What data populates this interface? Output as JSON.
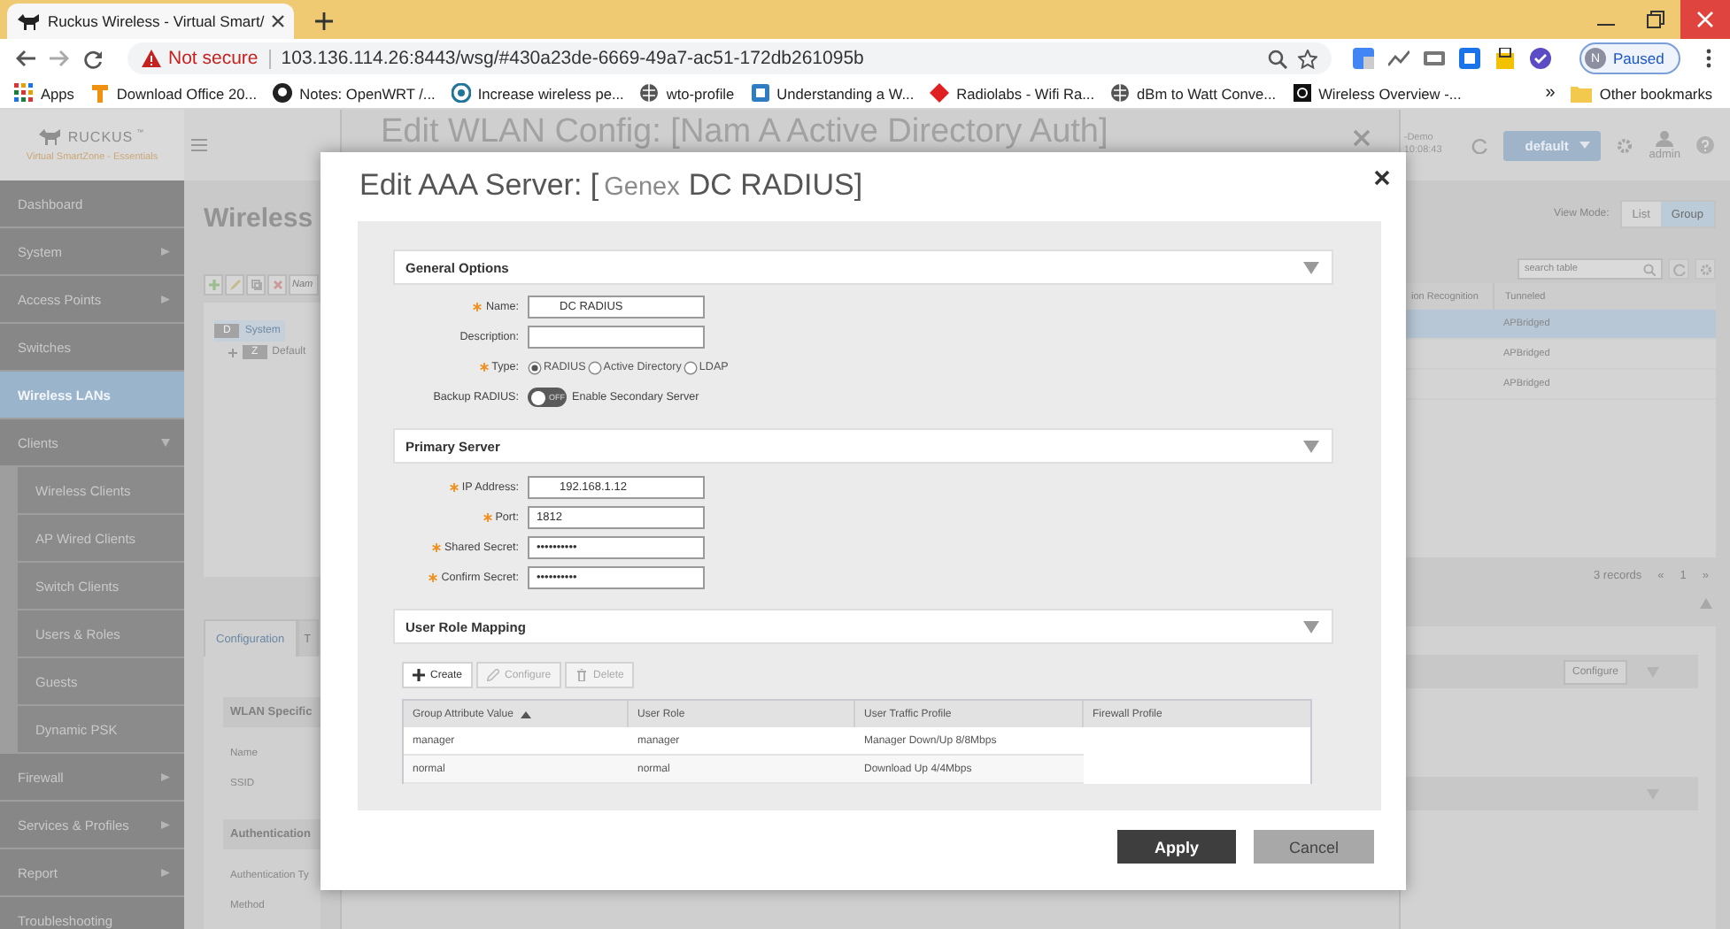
{
  "browser": {
    "tab_title": "Ruckus Wireless - Virtual Smart/",
    "security": "Not secure",
    "url": "103.136.114.26:8443/wsg/#430a23de-6669-49a7-ac51-172db261095b",
    "profile": {
      "initial": "N",
      "status": "Paused"
    },
    "bookmarks": [
      {
        "label": "Apps"
      },
      {
        "label": "Download Office 20..."
      },
      {
        "label": "Notes: OpenWRT /..."
      },
      {
        "label": "Increase wireless pe..."
      },
      {
        "label": "wto-profile"
      },
      {
        "label": "Understanding a W..."
      },
      {
        "label": "Radiolabs - Wifi Ra..."
      },
      {
        "label": "dBm to Watt Conve..."
      },
      {
        "label": "Wireless Overview -..."
      }
    ],
    "more": "»",
    "other_bookmarks": "Other bookmarks"
  },
  "app": {
    "logo": "RUCKUS",
    "logo_mark": "™",
    "product": "Virtual SmartZone - Essentials",
    "controller": {
      "name": "-Demo",
      "time": "10:08:43"
    },
    "domain": "default",
    "user": "admin",
    "sidebar": [
      {
        "label": "Dashboard",
        "selected": false
      },
      {
        "label": "System",
        "selected": false,
        "expanded": false
      },
      {
        "label": "Access Points",
        "selected": false,
        "expanded": false
      },
      {
        "label": "Switches",
        "selected": false
      },
      {
        "label": "Wireless LANs",
        "selected": true
      },
      {
        "label": "Clients",
        "selected": false,
        "expanded": true,
        "children": [
          {
            "label": "Wireless Clients",
            "selected": false
          },
          {
            "label": "AP Wired Clients",
            "selected": false
          },
          {
            "label": "Switch Clients",
            "selected": false
          },
          {
            "label": "Users & Roles",
            "selected": false
          },
          {
            "label": "Guests",
            "selected": false
          },
          {
            "label": "Dynamic PSK",
            "selected": false
          }
        ]
      },
      {
        "label": "Firewall",
        "selected": false,
        "expanded": false
      },
      {
        "label": "Services & Profiles",
        "selected": false,
        "expanded": false
      },
      {
        "label": "Report",
        "selected": false,
        "expanded": false
      },
      {
        "label": "Troubleshooting",
        "selected": false
      }
    ],
    "page": {
      "title": "Wireless",
      "filter_placeholder": "Nam",
      "tree": [
        {
          "badge": "D",
          "label": "System",
          "selected": true,
          "children": [
            {
              "badge": "Z",
              "label": "Default",
              "selected": false
            }
          ]
        }
      ],
      "view_mode": {
        "label": "View Mode:",
        "options": [
          {
            "label": "List",
            "selected": false
          },
          {
            "label": "Group",
            "selected": true
          }
        ]
      },
      "search": {
        "placeholder": "search table"
      },
      "table": {
        "columns": [
          "ion Recognition",
          "Tunneled"
        ],
        "rows": [
          {
            "tunneled": "APBridged",
            "selected": true
          },
          {
            "tunneled": "APBridged",
            "selected": false
          },
          {
            "tunneled": "APBridged",
            "selected": false
          }
        ]
      },
      "records": "3 records",
      "pager": {
        "prev": "«",
        "page": "1",
        "next": "»"
      },
      "detail_tabs": [
        {
          "label": "Configuration",
          "selected": true
        },
        {
          "label": "T",
          "selected": false
        }
      ],
      "detail": [
        {
          "kind": "section",
          "label": "WLAN Specific"
        },
        {
          "kind": "field",
          "label": "Name"
        },
        {
          "kind": "field",
          "label": "SSID"
        },
        {
          "kind": "section",
          "label": "Authentication"
        },
        {
          "kind": "field",
          "label": "Authentication Ty"
        },
        {
          "kind": "field",
          "label": "Method"
        }
      ],
      "configure": "Configure"
    }
  },
  "wlan_dialog": {
    "title": "Edit WLAN Config: [Nam A Active Directory Auth]"
  },
  "dialog": {
    "title": "Edit AAA Server: [",
    "title_tag": "Genex",
    "title_name": "DC RADIUS]",
    "sections": [
      {
        "title": "General Options",
        "expanded": true,
        "fields": [
          {
            "kind": "text",
            "label": "Name:",
            "required": true,
            "value": "DC RADIUS"
          },
          {
            "kind": "text",
            "label": "Description:",
            "required": false
          },
          {
            "kind": "radio",
            "label": "Type:",
            "required": true,
            "options": [
              {
                "label": "RADIUS",
                "selected": true
              },
              {
                "label": "Active Directory",
                "selected": false
              },
              {
                "label": "LDAP",
                "selected": false
              }
            ]
          },
          {
            "kind": "toggle",
            "label": "Backup RADIUS:",
            "required": false,
            "on": false,
            "state_text": "OFF",
            "caption": "Enable Secondary Server"
          }
        ]
      },
      {
        "title": "Primary Server",
        "expanded": true,
        "fields": [
          {
            "kind": "text",
            "label": "IP Address:",
            "required": true,
            "value": "192.168.1.12"
          },
          {
            "kind": "text",
            "label": "Port:",
            "required": true,
            "value": "1812"
          },
          {
            "kind": "text",
            "label": "Shared Secret:",
            "required": true,
            "value": "••••••••••"
          },
          {
            "kind": "text",
            "label": "Confirm Secret:",
            "required": true,
            "value": "••••••••••"
          }
        ]
      },
      {
        "title": "User Role Mapping",
        "expanded": true,
        "toolbar": [
          {
            "kind": "create",
            "label": "Create",
            "disabled": false
          },
          {
            "kind": "configure",
            "label": "Configure",
            "disabled": true
          },
          {
            "kind": "delete",
            "label": "Delete",
            "disabled": true
          }
        ],
        "table": {
          "columns": [
            {
              "label": "Group Attribute Value",
              "sorted": true
            },
            {
              "label": "User Role",
              "sorted": false
            },
            {
              "label": "User Traffic Profile",
              "sorted": false
            },
            {
              "label": "Firewall Profile",
              "sorted": false
            }
          ],
          "rows": [
            [
              "manager",
              "manager",
              "Manager Down/Up 8/8Mbps"
            ],
            [
              "normal",
              "normal",
              "Download Up 4/4Mbps"
            ]
          ]
        }
      }
    ],
    "buttons": [
      {
        "kind": "primary",
        "label": "Apply"
      },
      {
        "kind": "secondary",
        "label": "Cancel"
      }
    ]
  }
}
